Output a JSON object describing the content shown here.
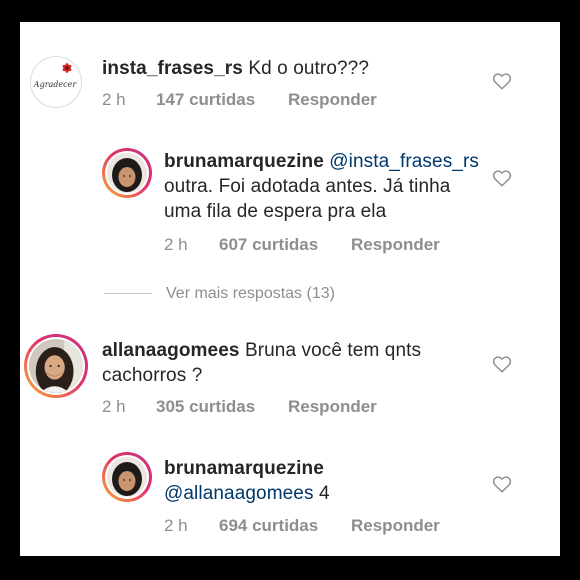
{
  "comments": [
    {
      "username": "insta_frases_rs",
      "text": "Kd o outro???",
      "time": "2 h",
      "likes": "147 curtidas",
      "reply": "Responder",
      "avatar_text": "Agradecer"
    },
    {
      "username": "brunamarquezine",
      "mention": "@insta_frases_rs",
      "text": "outra. Foi adotada antes. Já tinha uma fila de espera pra ela",
      "time": "2 h",
      "likes": "607 curtidas",
      "reply": "Responder"
    },
    {
      "username": "allanaagomees",
      "text": "Bruna você tem qnts cachorros ?",
      "time": "2 h",
      "likes": "305 curtidas",
      "reply": "Responder"
    },
    {
      "username": "brunamarquezine",
      "mention": "@allanaagomees",
      "text": "4",
      "time": "2 h",
      "likes": "694 curtidas",
      "reply": "Responder"
    }
  ],
  "view_more": "Ver mais respostas (13)",
  "icons": {
    "like": "heart-icon"
  },
  "colors": {
    "mention": "#00376b",
    "meta": "#8e8e8e",
    "text": "#262626"
  }
}
